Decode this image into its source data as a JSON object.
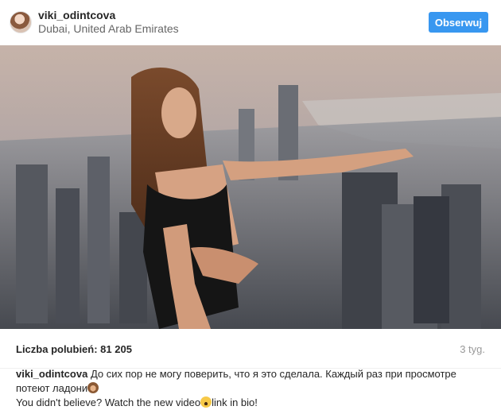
{
  "post": {
    "username": "viki_odintcova",
    "location": "Dubai, United Arab Emirates",
    "follow_label": "Obserwuj",
    "likes_text": "Liczba polubień: 81 205",
    "timestamp": "3 tyg.",
    "caption": {
      "username": "viki_odintcova",
      "line1": "До сих пор не могу поверить, что я это сделала. Каждый раз при просмотре потеют ладони",
      "line2_prefix": "You didn't believe? Watch the new video",
      "line2_suffix": "link in bio!",
      "emoji1": "see-no-evil-monkey",
      "emoji2": "screaming-face"
    }
  },
  "colors": {
    "accent": "#3897f0",
    "text": "#262626",
    "muted": "#999999"
  }
}
